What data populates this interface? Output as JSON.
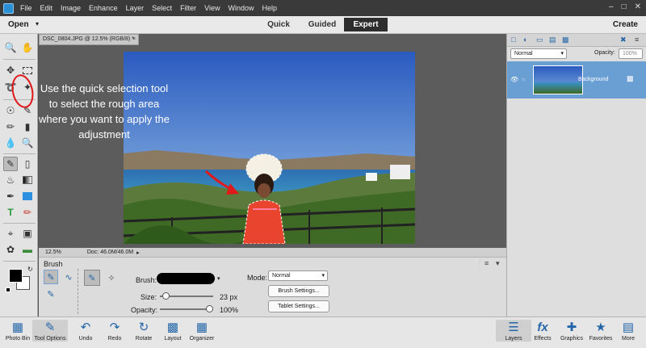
{
  "menubar": {
    "items": [
      "File",
      "Edit",
      "Image",
      "Enhance",
      "Layer",
      "Select",
      "Filter",
      "View",
      "Window",
      "Help"
    ]
  },
  "modebar": {
    "open_label": "Open",
    "modes": [
      "Quick",
      "Guided",
      "Expert"
    ],
    "active_mode": "Expert",
    "create_label": "Create"
  },
  "document": {
    "tab_title": "DSC_0804.JPG @ 12.5% (RGB/8) *",
    "zoom": "12.5%",
    "doc_size": "Doc: 46.0M/46.0M"
  },
  "annotation": {
    "text": "Use the quick selection tool to select the rough area where you want to apply the adjustment"
  },
  "options": {
    "tool_name": "Brush",
    "brush_label": "Brush:",
    "size_label": "Size:",
    "size_value": "23 px",
    "opacity_label": "Opacity:",
    "opacity_value": "100%",
    "size_level": 0.06,
    "opacity_level": 1.0,
    "mode_label": "Mode:",
    "mode_value": "Normal",
    "brush_settings": "Brush Settings...",
    "tablet_settings": "Tablet Settings..."
  },
  "layers": {
    "blend_mode": "Normal",
    "opacity_label": "Opacity:",
    "opacity_value": "100%",
    "layer_name": "Background"
  },
  "taskbar": {
    "left": [
      "Photo Bin",
      "Tool Options",
      "Undo",
      "Redo",
      "Rotate",
      "Layout",
      "Organizer"
    ],
    "right": [
      "Layers",
      "Effects",
      "Graphics",
      "Favorites",
      "More"
    ]
  },
  "colors": {
    "accent": "#2566a8",
    "layer_selected": "#6a9fd4",
    "annotation_red": "#e01a1a"
  }
}
